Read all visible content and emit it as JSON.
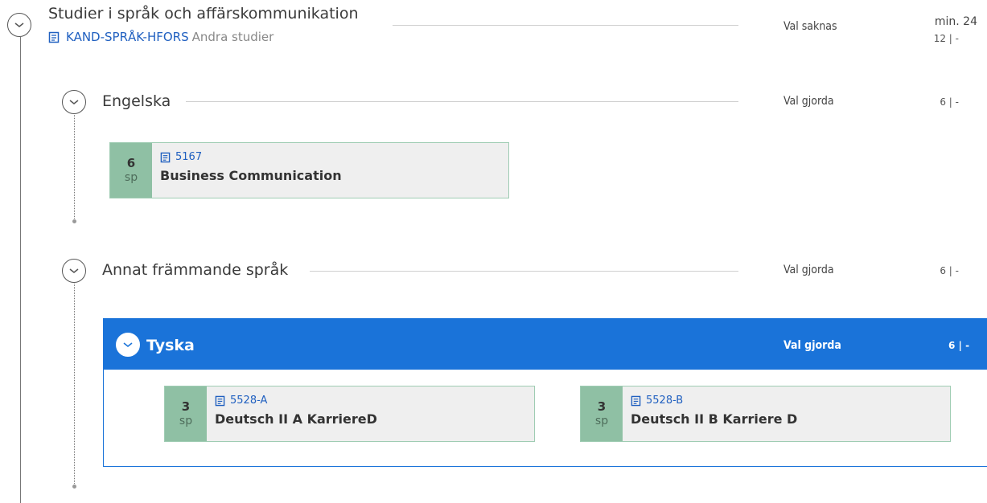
{
  "root": {
    "title": "Studier i språk och affärskommunikation",
    "code": "KAND-SPRÅK-HFORS",
    "subtitle": "Andra studier",
    "status": "Val saknas",
    "credits_min": "min. 24",
    "credits": "12 | -"
  },
  "groups": [
    {
      "title": "Engelska",
      "status": "Val gjorda",
      "credits": "6 | -",
      "courses": [
        {
          "credits": "6",
          "unit": "sp",
          "code": "5167",
          "name": "Business Communication"
        }
      ]
    },
    {
      "title": "Annat främmande språk",
      "status": "Val gjorda",
      "credits": "6 | -",
      "subgroup": {
        "title": "Tyska",
        "status": "Val gjorda",
        "credits": "6 | -",
        "courses": [
          {
            "credits": "3",
            "unit": "sp",
            "code": "5528-A",
            "name": "Deutsch II A KarriereD"
          },
          {
            "credits": "3",
            "unit": "sp",
            "code": "5528-B",
            "name": "Deutsch II B Karriere D"
          }
        ]
      }
    }
  ],
  "icons": {
    "expand": "chevron-down-icon",
    "document": "document-icon"
  },
  "colors": {
    "accent": "#1a73d9",
    "course_credit_bg": "#8fc0a4",
    "link": "#2060c0"
  }
}
